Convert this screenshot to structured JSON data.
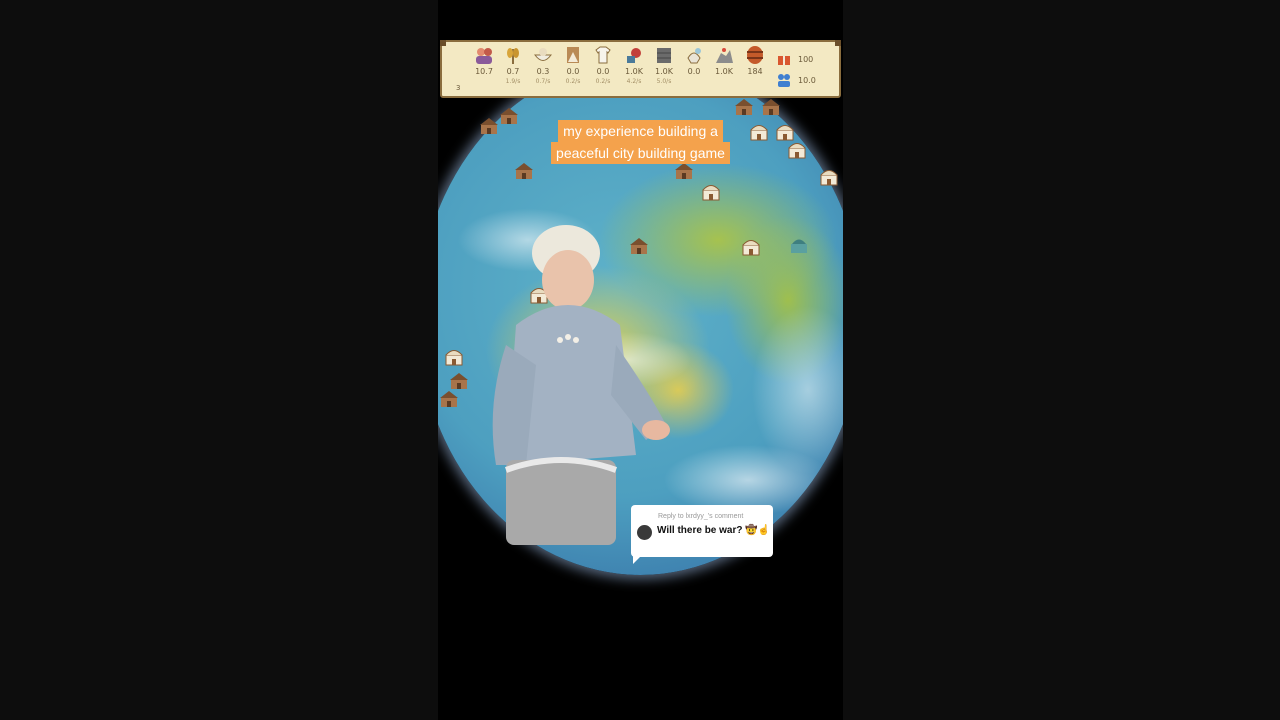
{
  "hud": {
    "resources": [
      {
        "icon": "population-icon",
        "value": "10.7",
        "rate": ""
      },
      {
        "icon": "wheat-icon",
        "value": "0.7",
        "rate": "1.9/s"
      },
      {
        "icon": "food-bowl-icon",
        "value": "0.3",
        "rate": "0.7/s"
      },
      {
        "icon": "wood-icon",
        "value": "0.0",
        "rate": "0.2/s"
      },
      {
        "icon": "cloth-icon",
        "value": "0.0",
        "rate": "0.2/s"
      },
      {
        "icon": "tools-icon",
        "value": "1.0K",
        "rate": "4.2/s"
      },
      {
        "icon": "bricks-icon",
        "value": "1.0K",
        "rate": "5.0/s"
      },
      {
        "icon": "faith-icon",
        "value": "0.0",
        "rate": ""
      },
      {
        "icon": "stone-icon",
        "value": "1.0K",
        "rate": ""
      },
      {
        "icon": "barrel-icon",
        "value": "184",
        "rate": ""
      }
    ],
    "right_stats": [
      {
        "icon": "gift-icon",
        "value": "100"
      },
      {
        "icon": "people-icon",
        "value": "10.0"
      }
    ],
    "turn": "3"
  },
  "caption": {
    "line1": "my experience building a",
    "line2": "peaceful city building game"
  },
  "comment": {
    "reply_to": "Reply to lxrdyy_'s comment",
    "text": "Will there be war? 🤠☝"
  },
  "colors": {
    "hud_bg": "#f3e9c3",
    "hud_border": "#8a6d3e",
    "caption_bg": "#f4a24c",
    "ocean": "#4d9fc0"
  }
}
